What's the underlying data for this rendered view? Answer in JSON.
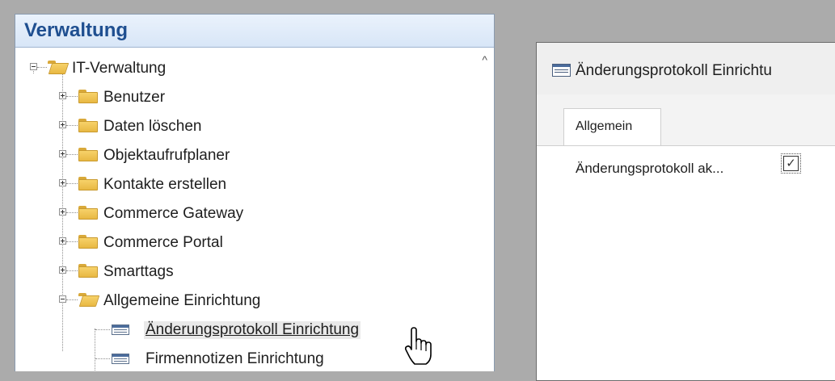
{
  "nav": {
    "title": "Verwaltung",
    "tree": [
      {
        "label": "IT-Verwaltung",
        "icon": "folder-open-icon",
        "expanded": true
      },
      {
        "label": "Benutzer",
        "icon": "folder-icon",
        "expanded": false
      },
      {
        "label": "Daten löschen",
        "icon": "folder-icon",
        "expanded": false
      },
      {
        "label": "Objektaufrufplaner",
        "icon": "folder-icon",
        "expanded": false
      },
      {
        "label": "Kontakte erstellen",
        "icon": "folder-icon",
        "expanded": false
      },
      {
        "label": "Commerce Gateway",
        "icon": "folder-icon",
        "expanded": false
      },
      {
        "label": "Commerce Portal",
        "icon": "folder-icon",
        "expanded": false
      },
      {
        "label": "Smarttags",
        "icon": "folder-icon",
        "expanded": false
      },
      {
        "label": "Allgemeine Einrichtung",
        "icon": "folder-open-icon",
        "expanded": true
      },
      {
        "label": "Änderungsprotokoll Einrichtung",
        "icon": "page-icon",
        "selected": true
      },
      {
        "label": "Firmennotizen Einrichtung",
        "icon": "page-icon"
      }
    ],
    "scroll_up_glyph": "^"
  },
  "dialog": {
    "title": "Änderungsprotokoll Einrichtu",
    "tab_label": "Allgemein",
    "field_label": "Änderungsprotokoll ak...",
    "checkbox_checked": true,
    "checkbox_glyph": "✓"
  },
  "colors": {
    "header_text": "#1f4f90",
    "background": "#ababab"
  }
}
